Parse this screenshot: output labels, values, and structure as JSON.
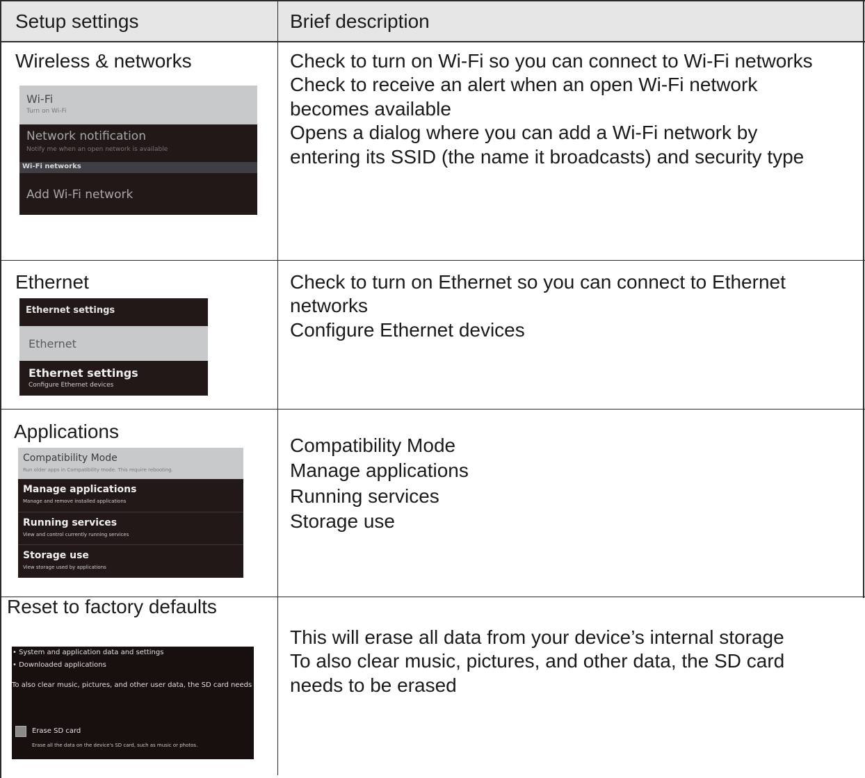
{
  "table": {
    "headers": {
      "setting": "Setup settings",
      "description": "Brief description"
    },
    "rows": [
      {
        "setting": "Wireless & networks",
        "description": [
          "Check to turn on Wi-Fi so you can connect to Wi-Fi networks",
          "Check to receive an alert when an open Wi-Fi network",
          "becomes available",
          "Opens a dialog where you can add a Wi-Fi network by",
          "entering its SSID (the name it broadcasts) and security type"
        ],
        "screen": {
          "wifi_title": "Wi-Fi",
          "wifi_sub": "Turn on Wi-Fi",
          "notif_title": "Network notification",
          "notif_sub": "Notify me when an open network is available",
          "section": "Wi-Fi networks",
          "add_title": "Add Wi-Fi network"
        }
      },
      {
        "setting": "Ethernet",
        "description": [
          "Check to turn on Ethernet so you can connect to Ethernet",
          "networks",
          "Configure Ethernet devices"
        ],
        "screen": {
          "header": "Ethernet settings",
          "toggle_title": "Ethernet",
          "settings_title": "Ethernet settings",
          "settings_sub": "Configure Ethernet devices"
        }
      },
      {
        "setting": "Applications",
        "description": [
          "Compatibility Mode",
          "Manage applications",
          "Running services",
          "Storage use"
        ],
        "screen": {
          "compat_title": "Compatibility Mode",
          "compat_sub": "Run older apps in Compatibility mode. This require rebooting.",
          "manage_title": "Manage applications",
          "manage_sub": "Manage and remove installed applications",
          "running_title": "Running services",
          "running_sub": "View and control currently running services",
          "storage_title": "Storage use",
          "storage_sub": "View storage used by applications"
        }
      },
      {
        "setting": "Reset to factory defaults",
        "description": [
          "This will erase all data from your device’s internal storage",
          "To also clear music, pictures, and other data, the SD card",
          "needs to be erased"
        ],
        "screen": {
          "bullet1": "• System and application data and settings",
          "bullet2": "• Downloaded applications",
          "note": "To also clear music, pictures, and other user data, the SD card needs to",
          "erase_title": "Erase SD card",
          "erase_sub": "Erase all the data on the device's SD card, such as music or photos."
        }
      }
    ]
  },
  "colors": {
    "header_bg": "#e6e6e6",
    "rule": "#2a2a2a",
    "screen_dark": "#221818",
    "screen_light": "#c8c9cb"
  }
}
